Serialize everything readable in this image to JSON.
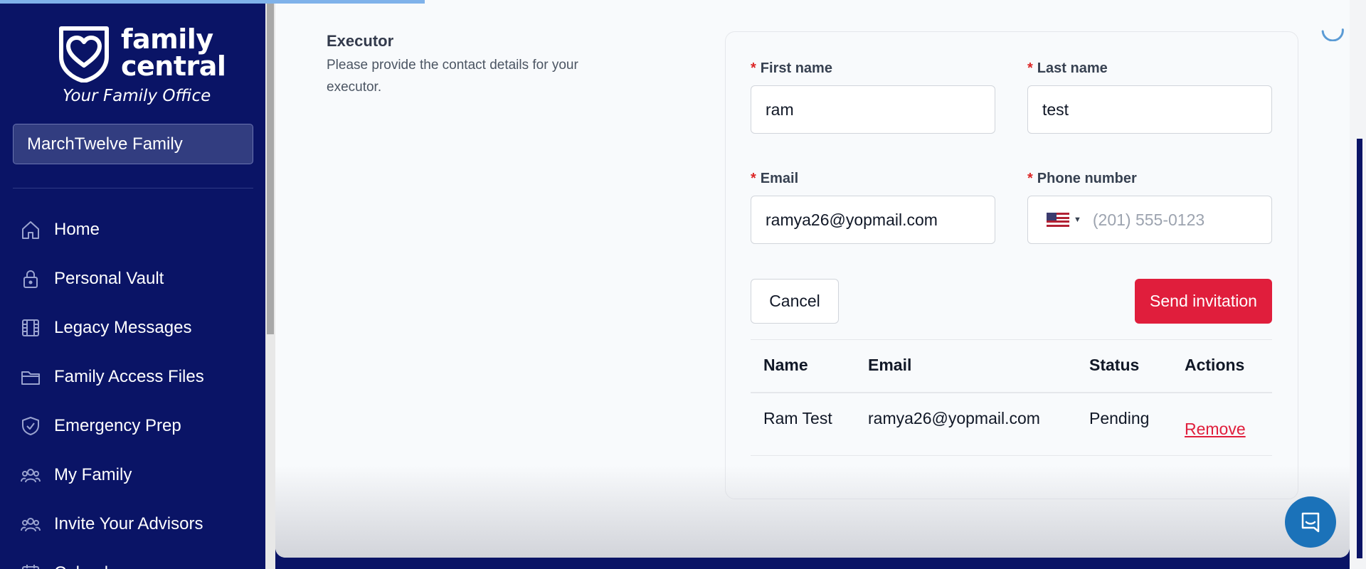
{
  "brand": {
    "name_line1": "family",
    "name_line2": "central",
    "tagline": "Your Family Office"
  },
  "family_selector": {
    "value": "MarchTwelve Family"
  },
  "nav": {
    "items": [
      {
        "label": "Home",
        "icon": "home-icon"
      },
      {
        "label": "Personal Vault",
        "icon": "lock-icon"
      },
      {
        "label": "Legacy Messages",
        "icon": "film-icon"
      },
      {
        "label": "Family Access Files",
        "icon": "folder-icon"
      },
      {
        "label": "Emergency Prep",
        "icon": "shield-check-icon"
      },
      {
        "label": "My Family",
        "icon": "users-icon"
      },
      {
        "label": "Invite Your Advisors",
        "icon": "users-icon"
      },
      {
        "label": "Calendar",
        "icon": "calendar-icon"
      }
    ]
  },
  "section": {
    "title": "Executor",
    "description": "Please provide the contact details for your executor."
  },
  "form": {
    "first_name": {
      "label": "First name",
      "value": "ram"
    },
    "last_name": {
      "label": "Last name",
      "value": "test"
    },
    "email": {
      "label": "Email",
      "value": "ramya26@yopmail.com"
    },
    "phone": {
      "label": "Phone number",
      "placeholder": "(201) 555-0123",
      "country": "US"
    },
    "required_marker": "*",
    "cancel_label": "Cancel",
    "send_label": "Send invitation"
  },
  "table": {
    "headers": {
      "name": "Name",
      "email": "Email",
      "status": "Status",
      "actions": "Actions"
    },
    "rows": [
      {
        "name": "Ram Test",
        "email": "ramya26@yopmail.com",
        "status": "Pending",
        "action": "Remove"
      }
    ]
  },
  "colors": {
    "sidebar_bg": "#0a1466",
    "accent_red": "#e01e3c",
    "chat_blue": "#1b72b9"
  }
}
